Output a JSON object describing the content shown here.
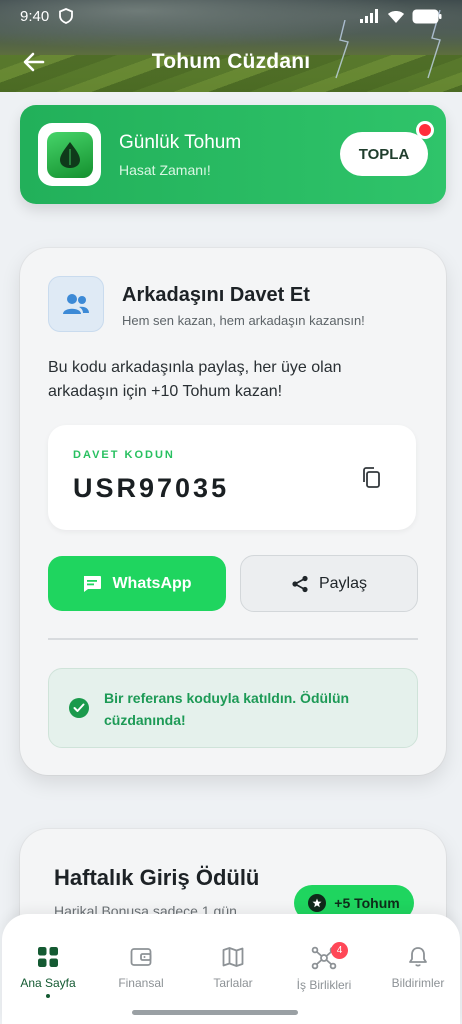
{
  "status_bar": {
    "time": "9:40"
  },
  "header": {
    "title": "Tohum Cüzdanı"
  },
  "daily_seed": {
    "title": "Günlük Tohum",
    "subtitle": "Hasat Zamanı!",
    "button": "TOPLA"
  },
  "invite": {
    "title": "Arkadaşını Davet Et",
    "subtitle": "Hem sen kazan, hem arkadaşın kazansın!",
    "description": "Bu kodu arkadaşınla paylaş, her üye olan arkadaşın için +10 Tohum kazan!",
    "code_label": "DAVET KODUN",
    "code": "USR97035",
    "whatsapp_label": "WhatsApp",
    "share_label": "Paylaş",
    "success_message": "Bir referans koduyla katıldın. Ödülün cüzdanında!"
  },
  "weekly": {
    "title": "Haftalık Giriş Ödülü",
    "subtitle": "Harikal Bonusa sadece 1 gün",
    "badge": "+5 Tohum"
  },
  "bottom_nav": {
    "items": [
      {
        "label": "Ana Sayfa",
        "icon": "grid-icon",
        "active": true
      },
      {
        "label": "Finansal",
        "icon": "wallet-icon",
        "active": false
      },
      {
        "label": "Tarlalar",
        "icon": "map-icon",
        "active": false
      },
      {
        "label": "İş Birlikleri",
        "icon": "network-icon",
        "active": false,
        "badge": "4"
      },
      {
        "label": "Bildirimler",
        "icon": "bell-icon",
        "active": false
      }
    ]
  },
  "colors": {
    "accent_green": "#22b05a",
    "whatsapp_green": "#1fd55f",
    "success_text": "#1d9a56",
    "badge_red": "#ff4757"
  }
}
